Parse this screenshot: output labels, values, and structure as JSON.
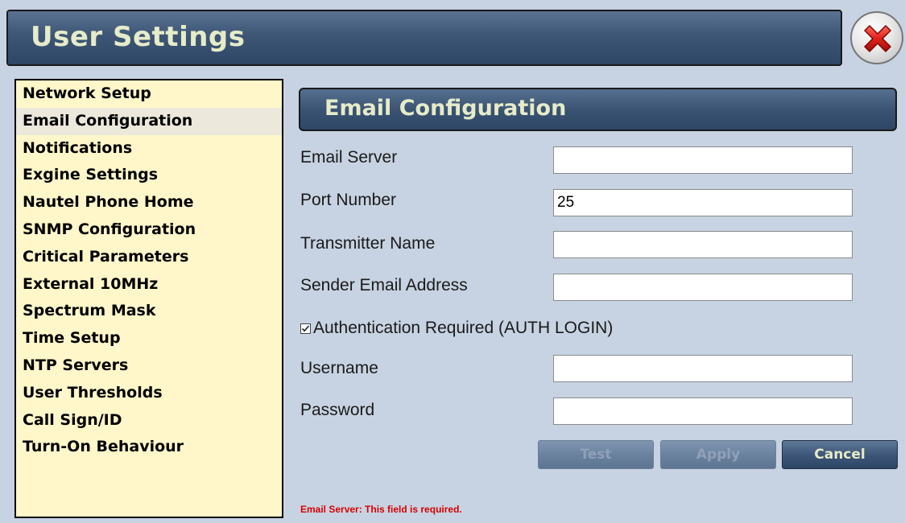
{
  "window": {
    "title": "User Settings",
    "close_icon": "close-x-icon"
  },
  "sidebar": {
    "items": [
      {
        "label": "Network Setup",
        "active": false
      },
      {
        "label": "Email Configuration",
        "active": true
      },
      {
        "label": "Notifications",
        "active": false
      },
      {
        "label": "Exgine Settings",
        "active": false
      },
      {
        "label": "Nautel Phone Home",
        "active": false
      },
      {
        "label": "SNMP Configuration",
        "active": false
      },
      {
        "label": "Critical Parameters",
        "active": false
      },
      {
        "label": "External 10MHz",
        "active": false
      },
      {
        "label": "Spectrum Mask",
        "active": false
      },
      {
        "label": "Time Setup",
        "active": false
      },
      {
        "label": "NTP Servers",
        "active": false
      },
      {
        "label": "User Thresholds",
        "active": false
      },
      {
        "label": "Call Sign/ID",
        "active": false
      },
      {
        "label": "Turn-On Behaviour",
        "active": false
      }
    ]
  },
  "main": {
    "section_title": "Email Configuration",
    "fields": {
      "email_server": {
        "label": "Email Server",
        "value": ""
      },
      "port_number": {
        "label": "Port Number",
        "value": "25"
      },
      "transmitter_name": {
        "label": "Transmitter Name",
        "value": ""
      },
      "sender_email": {
        "label": "Sender Email Address",
        "value": ""
      },
      "username": {
        "label": "Username",
        "value": ""
      },
      "password": {
        "label": "Password",
        "value": ""
      }
    },
    "auth": {
      "label": "Authentication Required (AUTH LOGIN)",
      "checked": true
    },
    "buttons": {
      "test": "Test",
      "apply": "Apply",
      "cancel": "Cancel"
    },
    "error": "Email Server: This field is required."
  },
  "colors": {
    "background": "#c7d3e2",
    "header": "#3e5676",
    "header_text": "#e6ebc9",
    "sidebar_bg": "#fff7c9",
    "error": "#d40000"
  }
}
